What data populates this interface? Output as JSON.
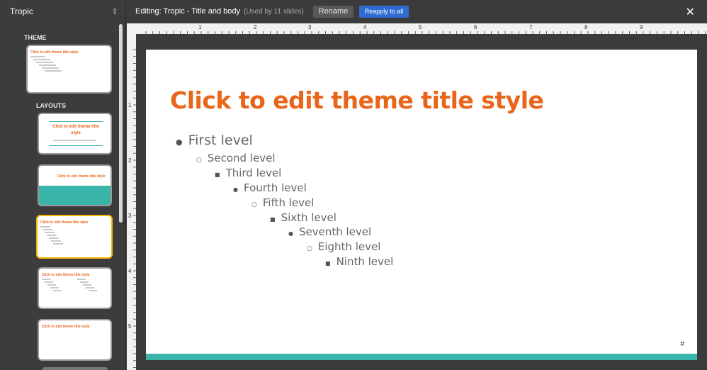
{
  "sidebar": {
    "theme_name": "Tropic",
    "theme_label": "THEME",
    "layouts_label": "LAYOUTS",
    "thumbs": [
      {
        "title": "Click to edit theme title style"
      },
      {
        "title": "Click to edit theme title style"
      },
      {
        "title": "Click to edit theme title style"
      },
      {
        "title": "Click to edit theme title style"
      },
      {
        "title": "Click to edit theme title style"
      },
      {
        "title": "Click to edit theme title style"
      }
    ]
  },
  "toolbar": {
    "editing_title": "Editing: Tropic - Title and body",
    "used_by": "(Used by 11 slides)",
    "rename_label": "Rename",
    "reapply_label": "Reapply to all",
    "close_icon": "close-icon"
  },
  "ruler": {
    "top_numbers": [
      "1",
      "2",
      "3",
      "4",
      "5",
      "6",
      "7",
      "8",
      "9"
    ],
    "left_numbers": [
      "1",
      "2",
      "3",
      "4",
      "5"
    ]
  },
  "slide": {
    "title": "Click to edit theme title style",
    "levels": [
      {
        "text": "First level",
        "bullet": "●"
      },
      {
        "text": "Second level",
        "bullet": "○"
      },
      {
        "text": "Third level",
        "bullet": "■"
      },
      {
        "text": "Fourth level",
        "bullet": "●"
      },
      {
        "text": "Fifth level",
        "bullet": "○"
      },
      {
        "text": "Sixth level",
        "bullet": "■"
      },
      {
        "text": "Seventh level",
        "bullet": "●"
      },
      {
        "text": "Eighth level",
        "bullet": "○"
      },
      {
        "text": "Ninth level",
        "bullet": "■"
      }
    ],
    "slide_number": "#"
  },
  "colors": {
    "accent_orange": "#e8651a",
    "accent_teal": "#3ab3a8",
    "reapply_blue": "#2f6cd1",
    "selected_border": "#f5b400"
  }
}
